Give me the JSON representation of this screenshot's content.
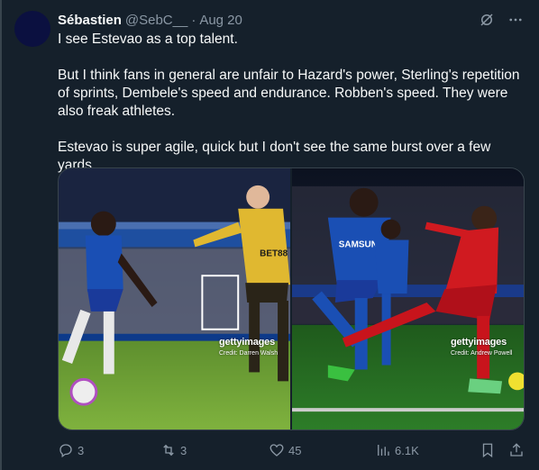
{
  "tweet": {
    "author_name": "Sébastien",
    "author_handle": "@SebC__",
    "separator": "·",
    "timestamp": "Aug 20",
    "paragraphs": [
      "I see Estevao as a top talent.",
      "But I think fans in general are unfair to Hazard's power, Sterling's repetition of sprints, Dembele's speed and endurance. Robben's speed. They were also freak athletes.",
      "Estevao is super agile, quick but I don't see the same burst over a few yards"
    ],
    "images": [
      {
        "watermark": "gettyimages",
        "credit": "Credit: Darren Walsh",
        "shirt_text": "BET88",
        "alt_icon": "photo"
      },
      {
        "watermark": "gettyimages",
        "credit": "Credit: Andrew Powell",
        "shirt_text": "SAMSUNG",
        "alt_icon": "photo"
      }
    ]
  },
  "actions": {
    "replies": "3",
    "reposts": "3",
    "likes": "45",
    "views": "6.1K"
  },
  "icons": {
    "grok": "grok-icon",
    "more": "more-icon",
    "reply": "reply-icon",
    "repost": "repost-icon",
    "like": "heart-icon",
    "views": "views-icon",
    "bookmark": "bookmark-icon",
    "share": "share-icon"
  },
  "colors": {
    "background": "#15202b",
    "text": "#f7f9f9",
    "secondary": "#8b98a5",
    "border": "#38444d"
  }
}
